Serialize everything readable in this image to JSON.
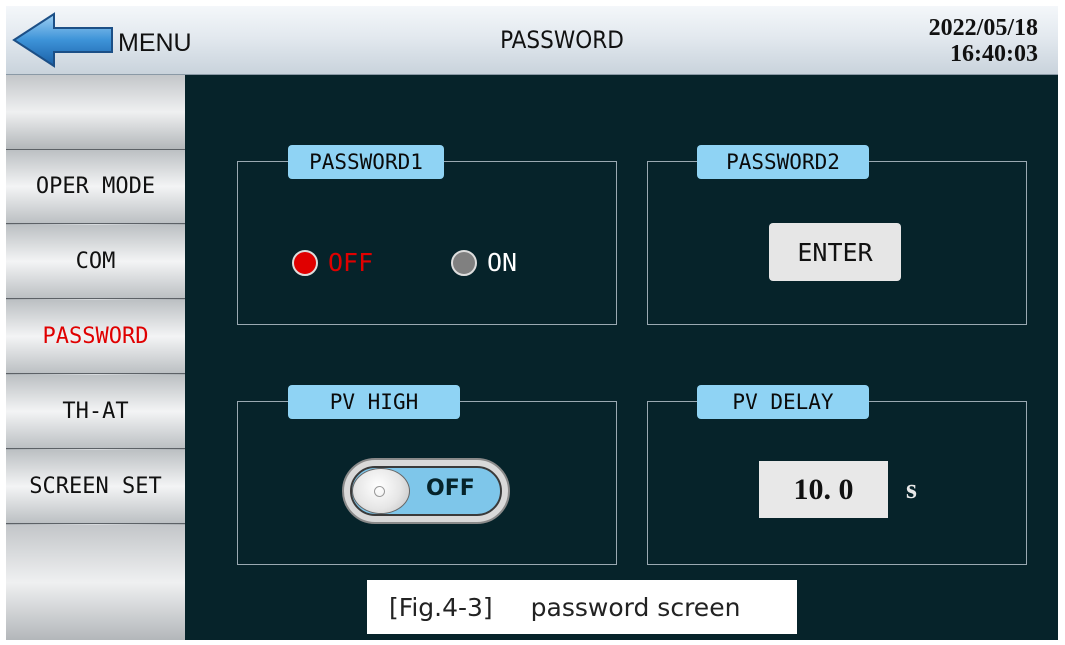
{
  "header": {
    "menu_label": "MENU",
    "title": "PASSWORD",
    "date": "2022/05/18",
    "time": "16:40:03"
  },
  "sidebar": {
    "items": [
      {
        "label": "OPER MODE",
        "active": false
      },
      {
        "label": "COM",
        "active": false
      },
      {
        "label": "PASSWORD",
        "active": true
      },
      {
        "label": "TH-AT",
        "active": false
      },
      {
        "label": "SCREEN SET",
        "active": false
      }
    ]
  },
  "password1": {
    "title": "PASSWORD1",
    "off_label": "OFF",
    "on_label": "ON",
    "selected": "OFF"
  },
  "password2": {
    "title": "PASSWORD2",
    "enter_label": "ENTER"
  },
  "pv_high": {
    "title": "PV HIGH",
    "toggle_label": "OFF"
  },
  "pv_delay": {
    "title": "PV DELAY",
    "value": "10. 0",
    "unit": "s"
  },
  "caption": {
    "fig": "[Fig.4-3]",
    "text": "password screen"
  },
  "colors": {
    "background": "#06232a",
    "label_bg": "#8fd3f4",
    "active": "#e00000",
    "radio_off": "#808080"
  }
}
